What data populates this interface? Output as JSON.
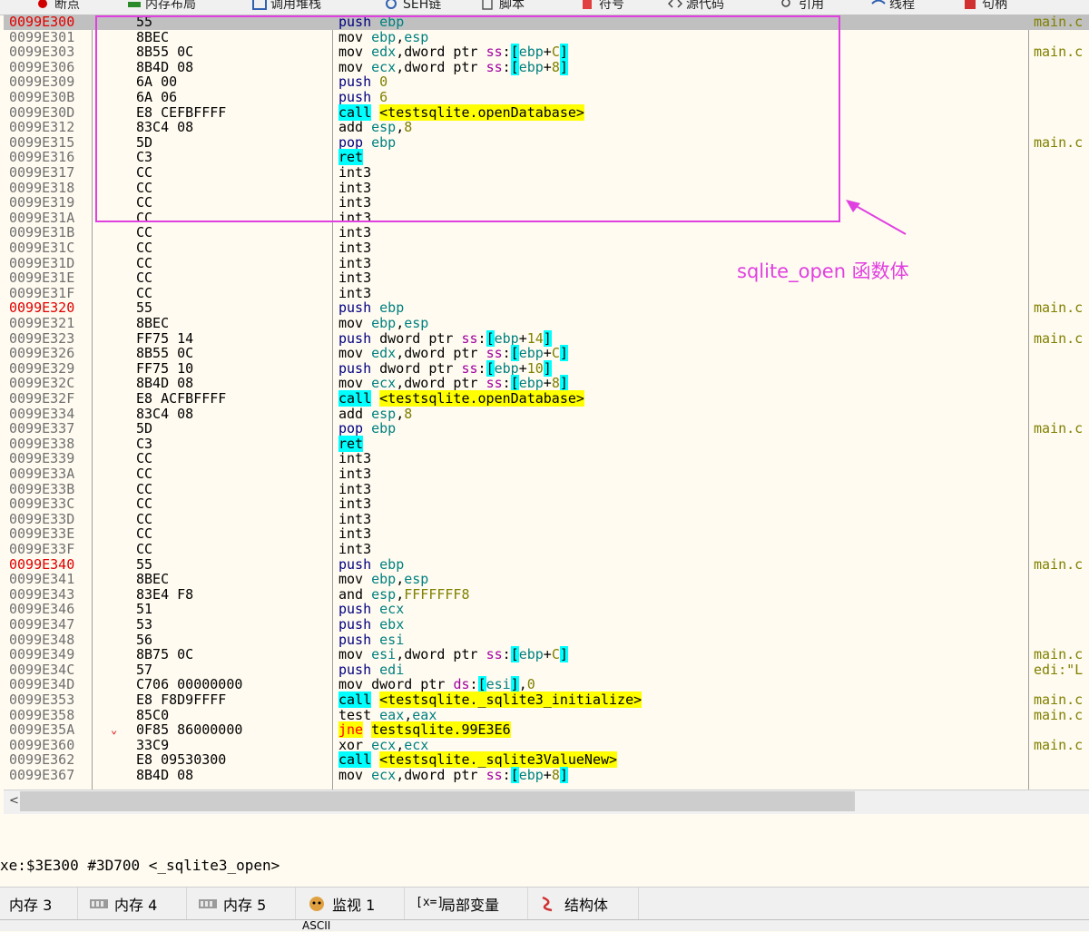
{
  "top_tabs": [
    {
      "label": "断点",
      "icon": "breakpoint-icon"
    },
    {
      "label": "内存布局",
      "icon": "memory-map-icon"
    },
    {
      "label": "调用堆栈",
      "icon": "call-stack-icon"
    },
    {
      "label": "SEH链",
      "icon": "seh-chain-icon"
    },
    {
      "label": "脚本",
      "icon": "script-icon"
    },
    {
      "label": "符号",
      "icon": "symbols-icon"
    },
    {
      "label": "源代码",
      "icon": "source-icon"
    },
    {
      "label": "引用",
      "icon": "references-icon"
    },
    {
      "label": "线程",
      "icon": "threads-icon"
    },
    {
      "label": "句柄",
      "icon": "handles-icon"
    }
  ],
  "rows": [
    {
      "addr": "0099E300",
      "bytes": "55",
      "instr": "push ebp",
      "comment": "main.c"
    },
    {
      "addr": "0099E301",
      "bytes": "8BEC",
      "instr": "mov ebp,esp",
      "comment": ""
    },
    {
      "addr": "0099E303",
      "bytes": "8B55 0C",
      "instr": "mov edx,dword ptr ss:[ebp+C]",
      "comment": "main.c"
    },
    {
      "addr": "0099E306",
      "bytes": "8B4D 08",
      "instr": "mov ecx,dword ptr ss:[ebp+8]",
      "comment": ""
    },
    {
      "addr": "0099E309",
      "bytes": "6A 00",
      "instr": "push 0",
      "comment": ""
    },
    {
      "addr": "0099E30B",
      "bytes": "6A 06",
      "instr": "push 6",
      "comment": ""
    },
    {
      "addr": "0099E30D",
      "bytes": "E8 CEFBFFFF",
      "instr": "call <testsqlite.openDatabase>",
      "comment": ""
    },
    {
      "addr": "0099E312",
      "bytes": "83C4 08",
      "instr": "add esp,8",
      "comment": ""
    },
    {
      "addr": "0099E315",
      "bytes": "5D",
      "instr": "pop ebp",
      "comment": "main.c"
    },
    {
      "addr": "0099E316",
      "bytes": "C3",
      "instr": "ret",
      "comment": ""
    },
    {
      "addr": "0099E317",
      "bytes": "CC",
      "instr": "int3",
      "comment": ""
    },
    {
      "addr": "0099E318",
      "bytes": "CC",
      "instr": "int3",
      "comment": ""
    },
    {
      "addr": "0099E319",
      "bytes": "CC",
      "instr": "int3",
      "comment": ""
    },
    {
      "addr": "0099E31A",
      "bytes": "CC",
      "instr": "int3",
      "comment": ""
    },
    {
      "addr": "0099E31B",
      "bytes": "CC",
      "instr": "int3",
      "comment": ""
    },
    {
      "addr": "0099E31C",
      "bytes": "CC",
      "instr": "int3",
      "comment": ""
    },
    {
      "addr": "0099E31D",
      "bytes": "CC",
      "instr": "int3",
      "comment": ""
    },
    {
      "addr": "0099E31E",
      "bytes": "CC",
      "instr": "int3",
      "comment": ""
    },
    {
      "addr": "0099E31F",
      "bytes": "CC",
      "instr": "int3",
      "comment": ""
    },
    {
      "addr": "0099E320",
      "bytes": "55",
      "instr": "push ebp",
      "comment": "main.c"
    },
    {
      "addr": "0099E321",
      "bytes": "8BEC",
      "instr": "mov ebp,esp",
      "comment": ""
    },
    {
      "addr": "0099E323",
      "bytes": "FF75 14",
      "instr": "push dword ptr ss:[ebp+14]",
      "comment": "main.c"
    },
    {
      "addr": "0099E326",
      "bytes": "8B55 0C",
      "instr": "mov edx,dword ptr ss:[ebp+C]",
      "comment": ""
    },
    {
      "addr": "0099E329",
      "bytes": "FF75 10",
      "instr": "push dword ptr ss:[ebp+10]",
      "comment": ""
    },
    {
      "addr": "0099E32C",
      "bytes": "8B4D 08",
      "instr": "mov ecx,dword ptr ss:[ebp+8]",
      "comment": ""
    },
    {
      "addr": "0099E32F",
      "bytes": "E8 ACFBFFFF",
      "instr": "call <testsqlite.openDatabase>",
      "comment": ""
    },
    {
      "addr": "0099E334",
      "bytes": "83C4 08",
      "instr": "add esp,8",
      "comment": ""
    },
    {
      "addr": "0099E337",
      "bytes": "5D",
      "instr": "pop ebp",
      "comment": "main.c"
    },
    {
      "addr": "0099E338",
      "bytes": "C3",
      "instr": "ret",
      "comment": ""
    },
    {
      "addr": "0099E339",
      "bytes": "CC",
      "instr": "int3",
      "comment": ""
    },
    {
      "addr": "0099E33A",
      "bytes": "CC",
      "instr": "int3",
      "comment": ""
    },
    {
      "addr": "0099E33B",
      "bytes": "CC",
      "instr": "int3",
      "comment": ""
    },
    {
      "addr": "0099E33C",
      "bytes": "CC",
      "instr": "int3",
      "comment": ""
    },
    {
      "addr": "0099E33D",
      "bytes": "CC",
      "instr": "int3",
      "comment": ""
    },
    {
      "addr": "0099E33E",
      "bytes": "CC",
      "instr": "int3",
      "comment": ""
    },
    {
      "addr": "0099E33F",
      "bytes": "CC",
      "instr": "int3",
      "comment": ""
    },
    {
      "addr": "0099E340",
      "bytes": "55",
      "instr": "push ebp",
      "comment": "main.c"
    },
    {
      "addr": "0099E341",
      "bytes": "8BEC",
      "instr": "mov ebp,esp",
      "comment": ""
    },
    {
      "addr": "0099E343",
      "bytes": "83E4 F8",
      "instr": "and esp,FFFFFFF8",
      "comment": ""
    },
    {
      "addr": "0099E346",
      "bytes": "51",
      "instr": "push ecx",
      "comment": ""
    },
    {
      "addr": "0099E347",
      "bytes": "53",
      "instr": "push ebx",
      "comment": ""
    },
    {
      "addr": "0099E348",
      "bytes": "56",
      "instr": "push esi",
      "comment": ""
    },
    {
      "addr": "0099E349",
      "bytes": "8B75 0C",
      "instr": "mov esi,dword ptr ss:[ebp+C]",
      "comment": "main.c"
    },
    {
      "addr": "0099E34C",
      "bytes": "57",
      "instr": "push edi",
      "comment": "edi:\"L"
    },
    {
      "addr": "0099E34D",
      "bytes": "C706 00000000",
      "instr": "mov dword ptr ds:[esi],0",
      "comment": ""
    },
    {
      "addr": "0099E353",
      "bytes": "E8 F8D9FFFF",
      "instr": "call <testsqlite._sqlite3_initialize>",
      "comment": "main.c"
    },
    {
      "addr": "0099E358",
      "bytes": "85C0",
      "instr": "test eax,eax",
      "comment": "main.c"
    },
    {
      "addr": "0099E35A",
      "bytes": "0F85 86000000",
      "instr": "jne testsqlite.99E3E6",
      "comment": ""
    },
    {
      "addr": "0099E360",
      "bytes": "33C9",
      "instr": "xor ecx,ecx",
      "comment": "main.c"
    },
    {
      "addr": "0099E362",
      "bytes": "E8 09530300",
      "instr": "call <testsqlite._sqlite3ValueNew>",
      "comment": ""
    },
    {
      "addr": "0099E367",
      "bytes": "8B4D 08",
      "instr": "mov ecx,dword ptr ss:[ebp+8]",
      "comment": ""
    }
  ],
  "annotation": {
    "label": "sqlite_open 函数体",
    "color": "#e040e0"
  },
  "status": {
    "info_text": "xe:$3E300 #3D700 <_sqlite3_open>"
  },
  "bottom_tabs": [
    {
      "label": "内存 3",
      "icon": "memory-icon"
    },
    {
      "label": "内存 4",
      "icon": "memory-icon"
    },
    {
      "label": "内存 5",
      "icon": "memory-icon"
    },
    {
      "label": "监视 1",
      "icon": "watch-icon"
    },
    {
      "label": "局部变量",
      "icon": "locals-icon"
    },
    {
      "label": "结构体",
      "icon": "struct-icon"
    }
  ],
  "bottom_strip": {
    "ascii_label": "ASCII"
  }
}
